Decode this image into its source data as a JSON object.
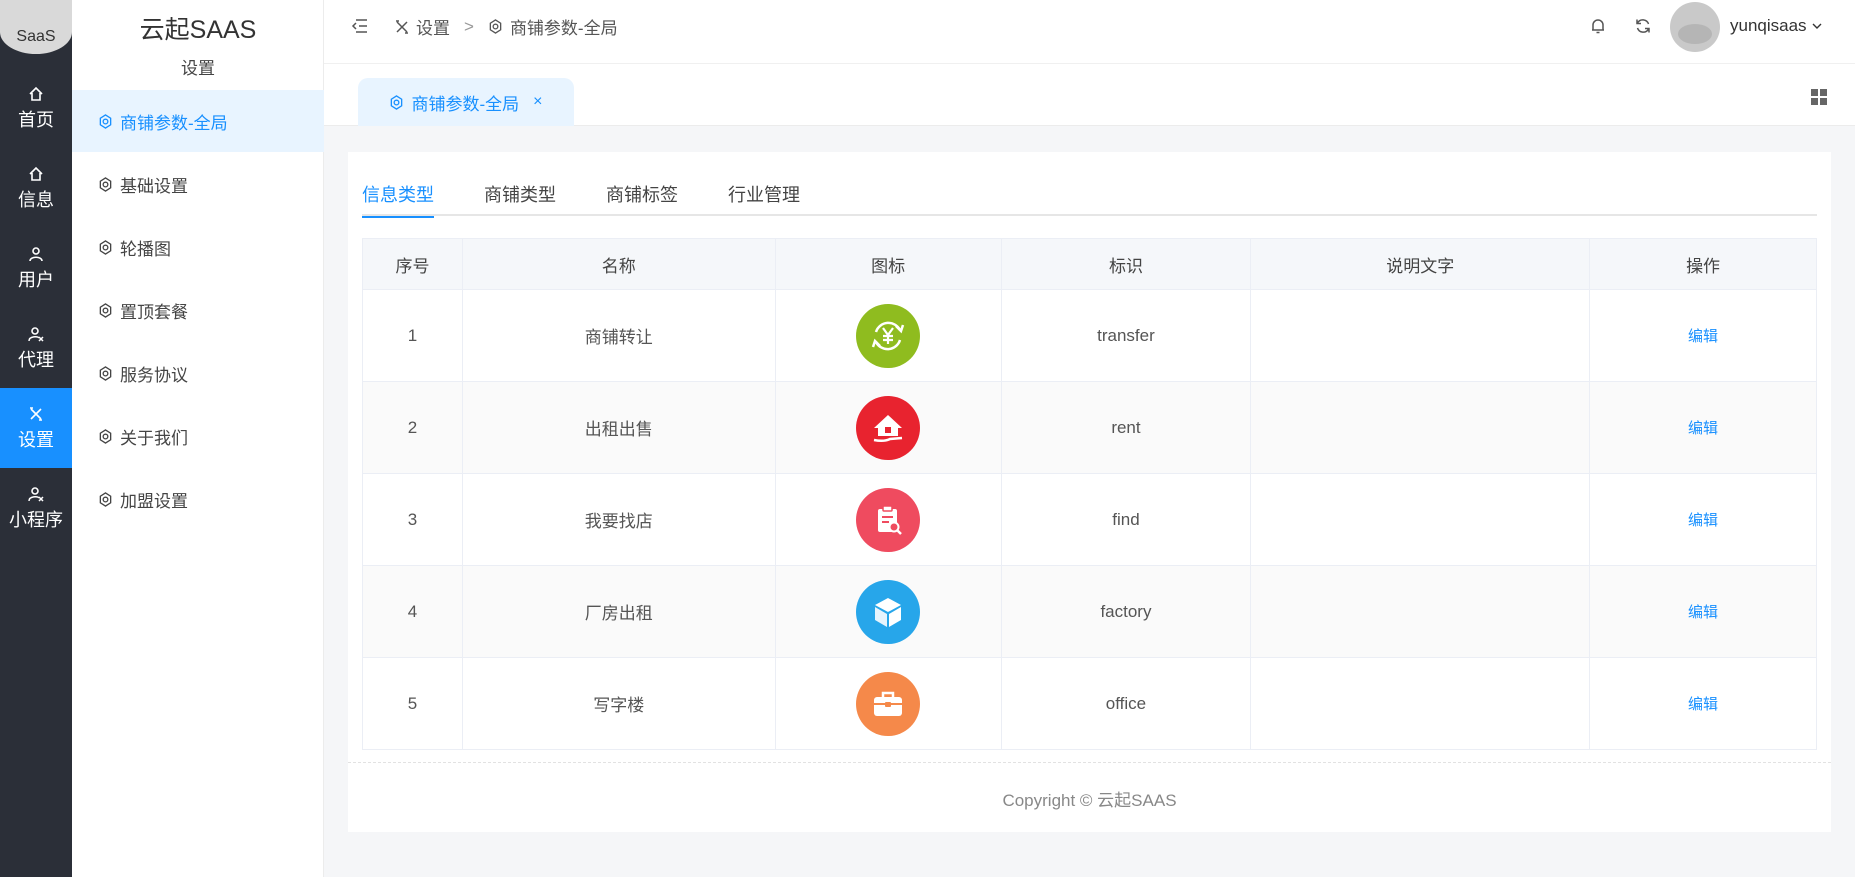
{
  "rail": {
    "logo": "SaaS",
    "items": [
      {
        "label": "首页",
        "icon": "home-icon"
      },
      {
        "label": "信息",
        "icon": "home-icon"
      },
      {
        "label": "用户",
        "icon": "user-icon"
      },
      {
        "label": "代理",
        "icon": "agent-icon"
      },
      {
        "label": "设置",
        "icon": "tools-icon"
      },
      {
        "label": "小程序",
        "icon": "agent-icon"
      }
    ],
    "active_index": 4,
    "active_color": "#1890ff"
  },
  "sidebar": {
    "title": "云起SAAS",
    "subtitle": "设置",
    "items": [
      {
        "label": "商铺参数-全局",
        "icon": "gear-icon"
      },
      {
        "label": "基础设置",
        "icon": "gear-icon"
      },
      {
        "label": "轮播图",
        "icon": "gear-icon"
      },
      {
        "label": "置顶套餐",
        "icon": "gear-icon"
      },
      {
        "label": "服务协议",
        "icon": "gear-icon"
      },
      {
        "label": "关于我们",
        "icon": "gear-icon"
      },
      {
        "label": "加盟设置",
        "icon": "gear-icon"
      }
    ]
  },
  "header": {
    "breadcrumb": [
      "设置",
      "商铺参数-全局"
    ],
    "breadcrumb_sep": ">",
    "username": "yunqisaas"
  },
  "tabstrip": {
    "tab_label": "商铺参数-全局",
    "close": "×"
  },
  "main": {
    "tabs": [
      "信息类型",
      "商铺类型",
      "商铺标签",
      "行业管理"
    ],
    "table": {
      "columns": [
        "序号",
        "名称",
        "图标",
        "标识",
        "说明文字",
        "操作"
      ],
      "rows": [
        {
          "no": "1",
          "name": "商铺转让",
          "icon": "exchange-yen-icon",
          "color": "#8fbc1f",
          "key": "transfer",
          "desc": "",
          "action": "编辑"
        },
        {
          "no": "2",
          "name": "出租出售",
          "icon": "house-hand-icon",
          "color": "#e8232f",
          "key": "rent",
          "desc": "",
          "action": "编辑"
        },
        {
          "no": "3",
          "name": "我要找店",
          "icon": "clipboard-search-icon",
          "color": "#ef4b5f",
          "key": "find",
          "desc": "",
          "action": "编辑"
        },
        {
          "no": "4",
          "name": "厂房出租",
          "icon": "cube-icon",
          "color": "#27a6ea",
          "key": "factory",
          "desc": "",
          "action": "编辑"
        },
        {
          "no": "5",
          "name": "写字楼",
          "icon": "briefcase-icon",
          "color": "#f5894a",
          "key": "office",
          "desc": "",
          "action": "编辑"
        }
      ]
    },
    "copyright": "Copyright ©  云起SAAS"
  }
}
